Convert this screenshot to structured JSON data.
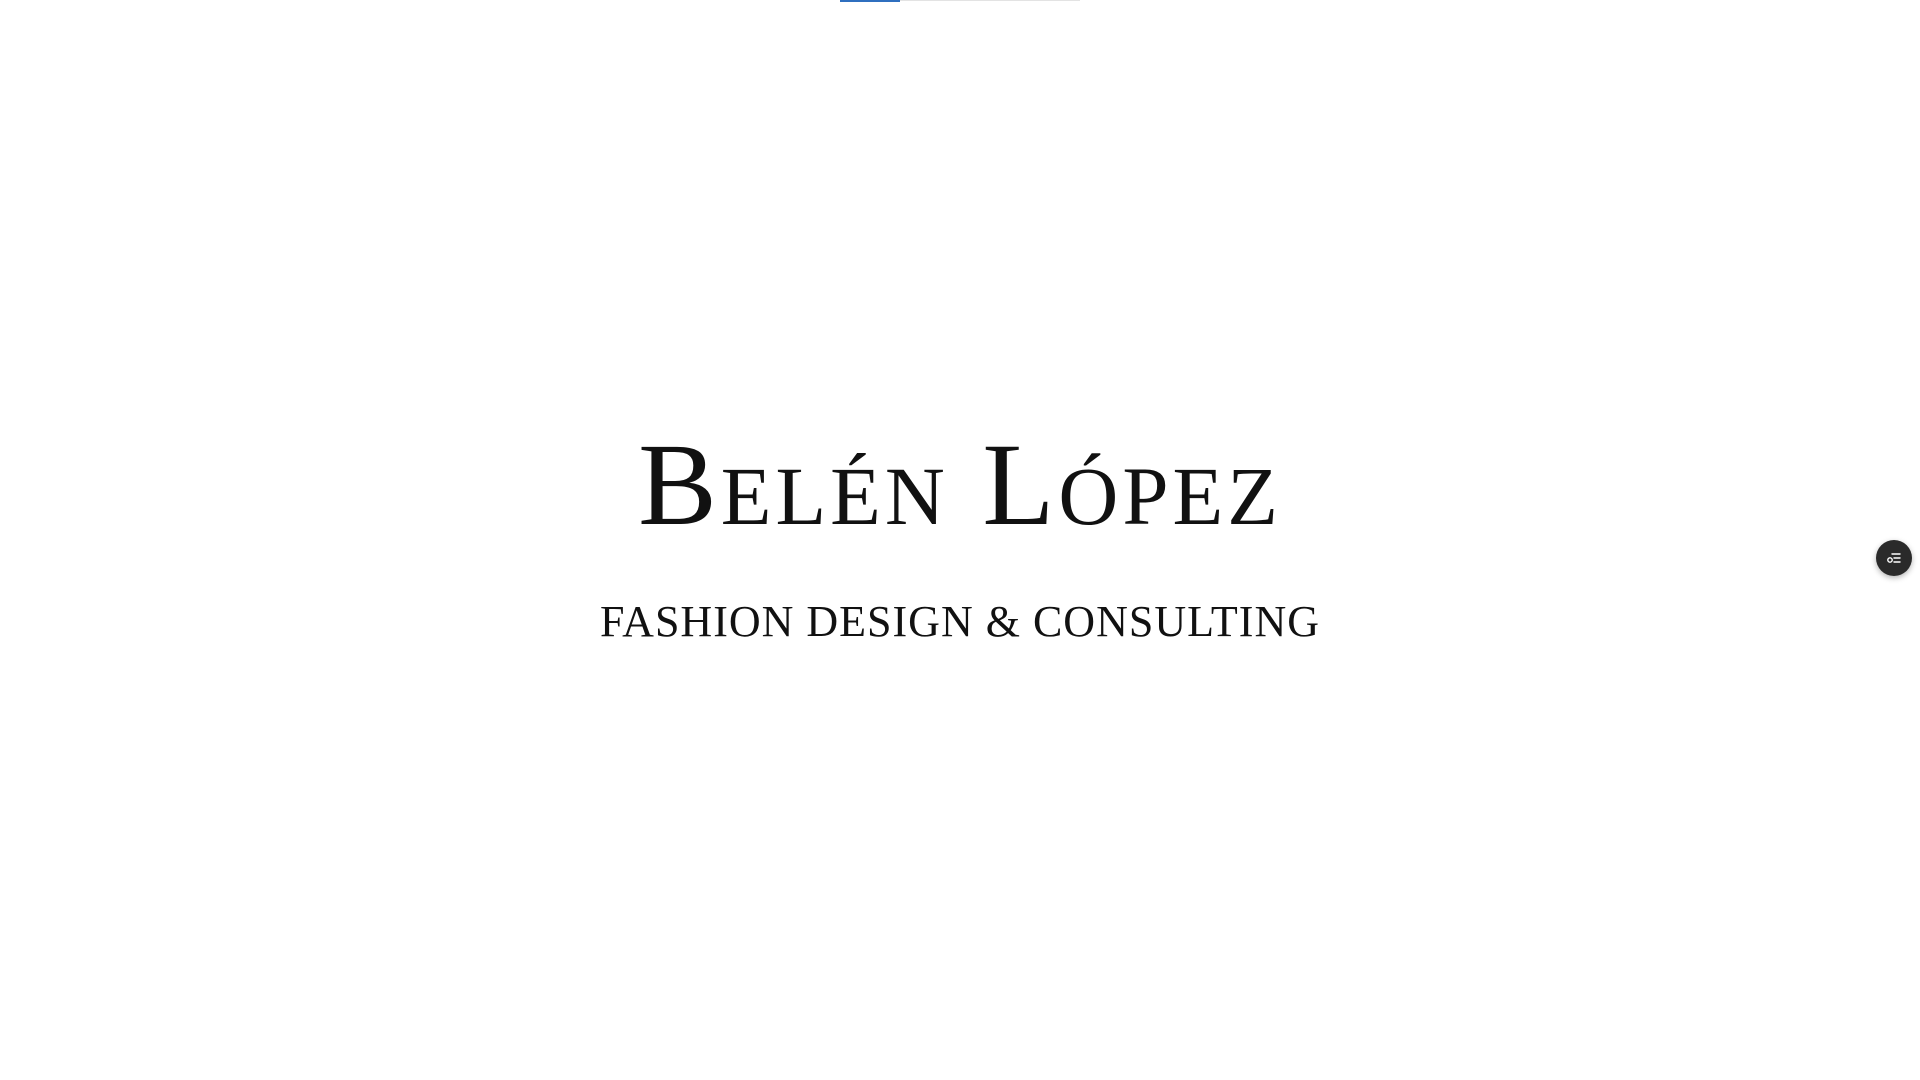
{
  "progress": {
    "value": 0.25,
    "color": "#2f6fbf"
  },
  "hero": {
    "title": "Belén López",
    "tagline": "FASHION DESIGN & CONSULTING"
  },
  "floating_button": {
    "icon": "settings-list-icon",
    "background": "#2a2a2a"
  }
}
